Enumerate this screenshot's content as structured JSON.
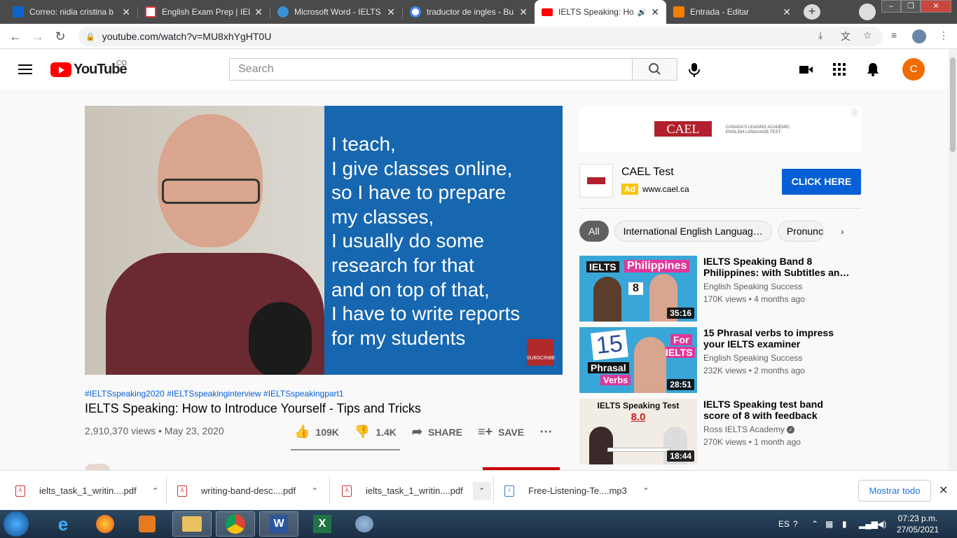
{
  "browser": {
    "tabs": [
      {
        "title": "Correo: nidia cristina b",
        "icon_color": "#0a64c9",
        "active": false
      },
      {
        "title": "English Exam Prep | IELT",
        "icon_color": "#d23a3a",
        "active": false
      },
      {
        "title": "Microsoft Word - IELTS",
        "icon_color": "#3b8fd6",
        "active": false
      },
      {
        "title": "traductor de ingles - Bu",
        "icon_color": "#4285f4",
        "active": false
      },
      {
        "title": "IELTS Speaking: Ho",
        "icon_color": "#ff0000",
        "active": true
      },
      {
        "title": "Entrada - Editar",
        "icon_color": "#f57d00",
        "active": false
      }
    ],
    "url": "youtube.com/watch?v=MU8xhYgHT0U"
  },
  "youtube": {
    "logo_text": "YouTube",
    "region": "CO",
    "search_placeholder": "Search",
    "avatar_letter": "C"
  },
  "video": {
    "caption_lines": [
      "I teach,",
      "I give classes online,",
      "so I have to prepare",
      "my classes,",
      "I usually do some",
      "research for that",
      "and on top of that,",
      "I have to write reports",
      "for my students"
    ],
    "subscribe_badge": "SUBSCRIBE",
    "hashtags": "#IELTSspeaking2020 #IELTSspeakinginterview #IELTSspeakingpart1",
    "title": "IELTS Speaking: How to Introduce Yourself - Tips and Tricks",
    "meta": "2,910,370 views • May 23, 2020",
    "likes": "109K",
    "dislikes": "1.4K",
    "share_label": "SHARE",
    "save_label": "SAVE"
  },
  "ad": {
    "brand_logo": "CAEL",
    "tagline": "CANADA'S LEADING ACADEMIC ENGLISH LANGUAGE TEST",
    "title": "CAEL Test",
    "badge": "Ad",
    "url": "www.cael.ca",
    "cta": "CLICK HERE"
  },
  "chips": [
    "All",
    "International English Languag…",
    "Pronunc"
  ],
  "recommendations": [
    {
      "title": "IELTS Speaking Band 8 Philippines: with Subtitles an…",
      "channel": "English Speaking Success",
      "views": "170K views • 4 months ago",
      "duration": "35:16",
      "thumb_text": [
        "IELTS",
        "Philippines",
        "8"
      ]
    },
    {
      "title": "15 Phrasal verbs to impress your IELTS examiner",
      "channel": "English Speaking Success",
      "views": "232K views • 2 months ago",
      "duration": "28:51",
      "thumb_text": [
        "15",
        "Phrasal",
        "Verbs",
        "For",
        "IELTS"
      ]
    },
    {
      "title": "IELTS Speaking test band score of 8 with feedback",
      "channel": "Ross IELTS Academy",
      "verified": true,
      "views": "270K views • 1 month ago",
      "duration": "18:44",
      "thumb_text": [
        "IELTS Speaking Test",
        "8.0"
      ]
    }
  ],
  "downloads": {
    "items": [
      {
        "name": "ielts_task_1_writin....pdf"
      },
      {
        "name": "writing-band-desc....pdf"
      },
      {
        "name": "ielts_task_1_writin....pdf"
      },
      {
        "name": "Free-Listening-Te....mp3"
      }
    ],
    "show_all": "Mostrar todo"
  },
  "taskbar": {
    "lang": "ES",
    "time": "07:23 p.m.",
    "date": "27/05/2021"
  }
}
